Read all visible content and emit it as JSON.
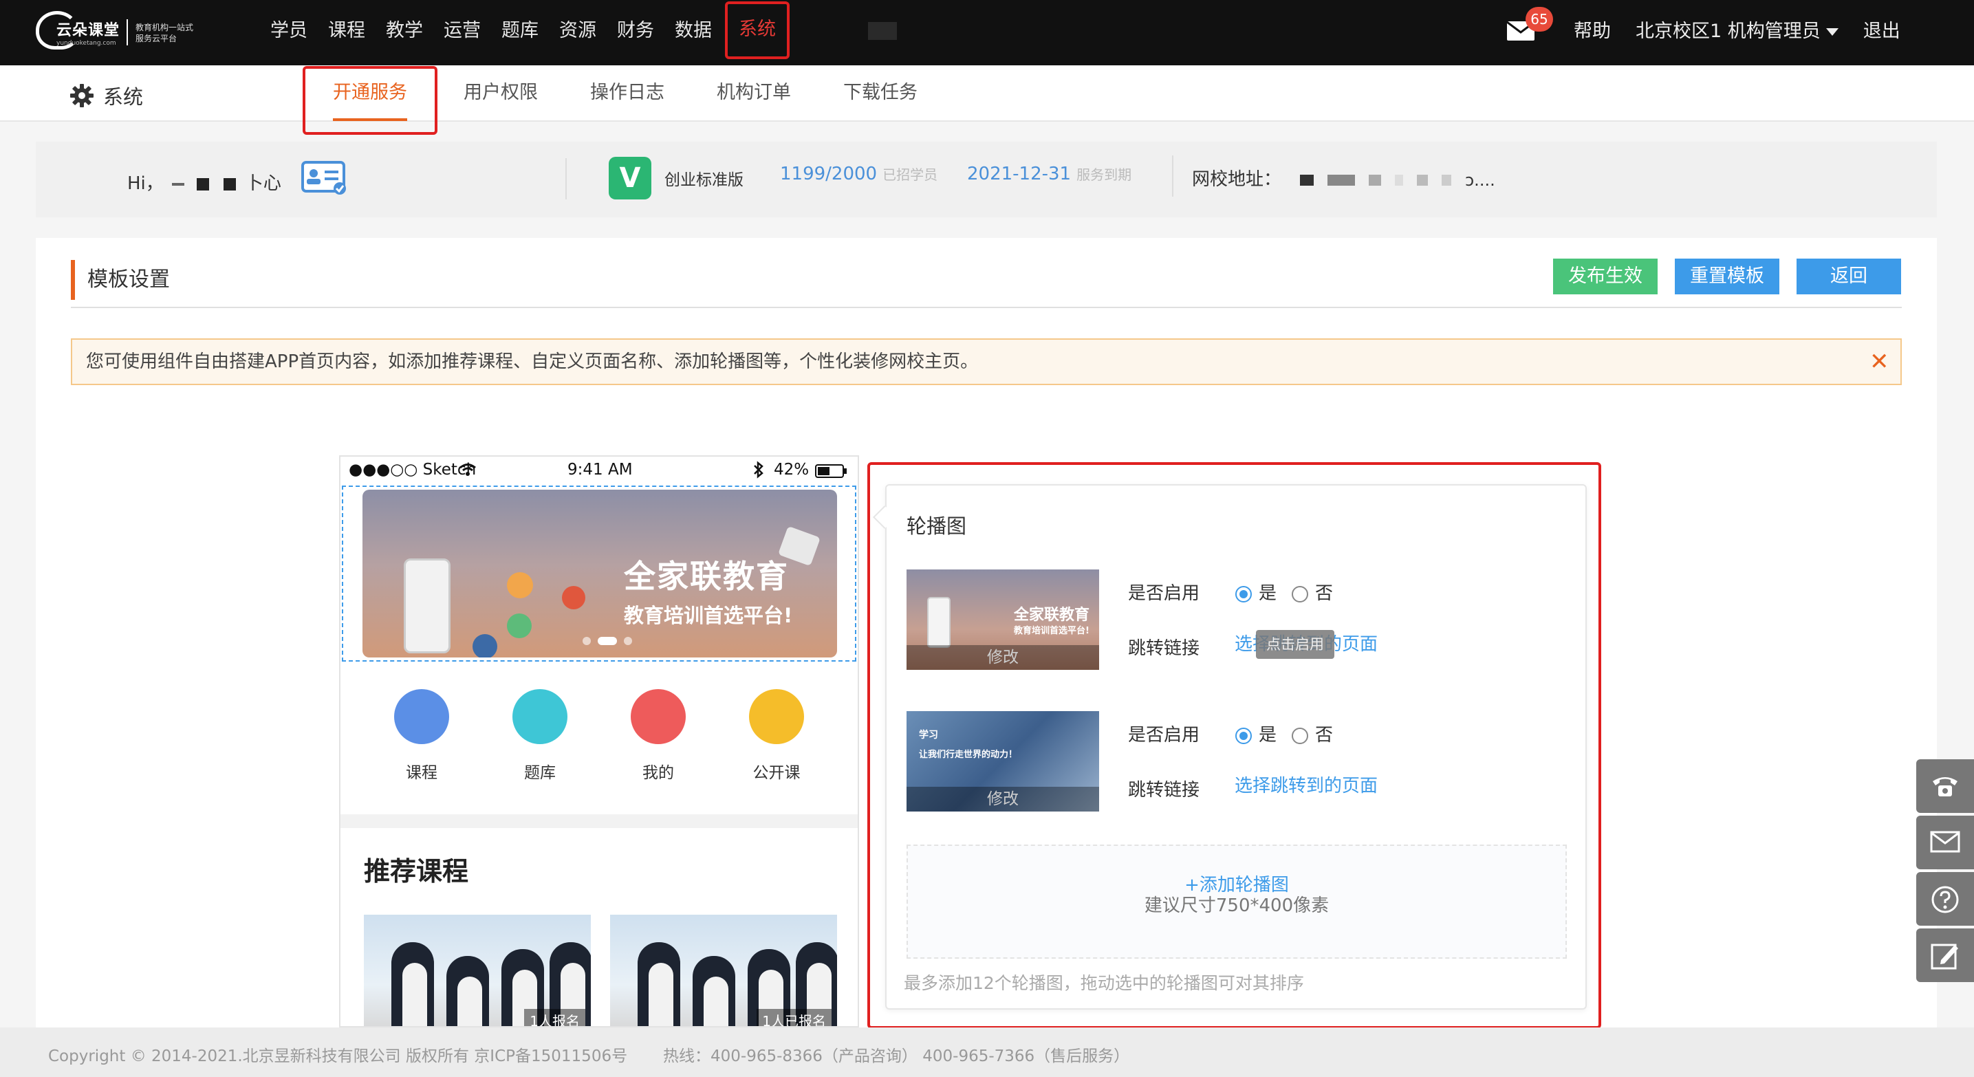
{
  "brand": {
    "name": "云朵课堂",
    "domain": "yunduoketang.com",
    "slogan": "教育机构一站式服务云平台"
  },
  "topnav": {
    "items": [
      "学员",
      "课程",
      "教学",
      "运营",
      "题库",
      "资源",
      "财务",
      "数据",
      "系统"
    ],
    "active": "系统",
    "mail_badge": "65",
    "help": "帮助",
    "campus": "北京校区1",
    "role": "机构管理员",
    "logout": "退出"
  },
  "subnav": {
    "title": "系统",
    "tabs": [
      "开通服务",
      "用户权限",
      "操作日志",
      "机构订单",
      "下载任务"
    ],
    "active": "开通服务"
  },
  "infobar": {
    "greeting": "Hi，",
    "user_suffix": "卜心",
    "edition": "创业标准版",
    "students": "1199/2000",
    "students_label": "已招学员",
    "expire_date": "2021-12-31",
    "expire_label": "服务到期",
    "school_label": "网校地址：",
    "school_url_tail": "ɔ...."
  },
  "section": {
    "title": "模板设置",
    "btn_publish": "发布生效",
    "btn_reset": "重置模板",
    "btn_back": "返回",
    "notice": "您可使用组件自由搭建APP首页内容，如添加推荐课程、自定义页面名称、添加轮播图等，个性化装修网校主页。",
    "notice_close": "✕"
  },
  "phone": {
    "carrier": "●●●○○ Sketch",
    "time": "9:41 AM",
    "battery": "42%",
    "banner_title": "全家联教育",
    "banner_sub": "教育培训首选平台!",
    "icons": [
      {
        "label": "课程",
        "color": "#5b8fe6"
      },
      {
        "label": "题库",
        "color": "#3ec6d6"
      },
      {
        "label": "我的",
        "color": "#ee5b5b"
      },
      {
        "label": "公开课",
        "color": "#f5bd2a"
      }
    ],
    "recommend_title": "推荐课程",
    "course_tags": [
      "1人报名",
      "1人已报名"
    ]
  },
  "carousel": {
    "title": "轮播图",
    "slides": [
      {
        "enable_label": "是否启用",
        "yes": "是",
        "no": "否",
        "enabled": true,
        "link_label": "跳转链接",
        "link_text": "选择跳转到的页面",
        "thumb_title": "全家联教育",
        "thumb_sub": "教育培训首选平台!",
        "edit": "修改"
      },
      {
        "enable_label": "是否启用",
        "yes": "是",
        "no": "否",
        "enabled": true,
        "link_label": "跳转链接",
        "link_text": "选择跳转到的页面",
        "thumb_title": "学习",
        "thumb_sub": "让我们行走世界的动力！",
        "edit": "修改"
      }
    ],
    "tooltip": "点击启用",
    "add_label": "+添加轮播图",
    "add_hint": "建议尺寸750*400像素",
    "footer_hint": "最多添加12个轮播图，拖动选中的轮播图可对其排序"
  },
  "footer": {
    "copyright": "Copyright © 2014-2021.北京昱新科技有限公司 版权所有 京ICP备15011506号",
    "hotline": "热线：400-965-8366（产品咨询） 400-965-7366（售后服务）"
  }
}
